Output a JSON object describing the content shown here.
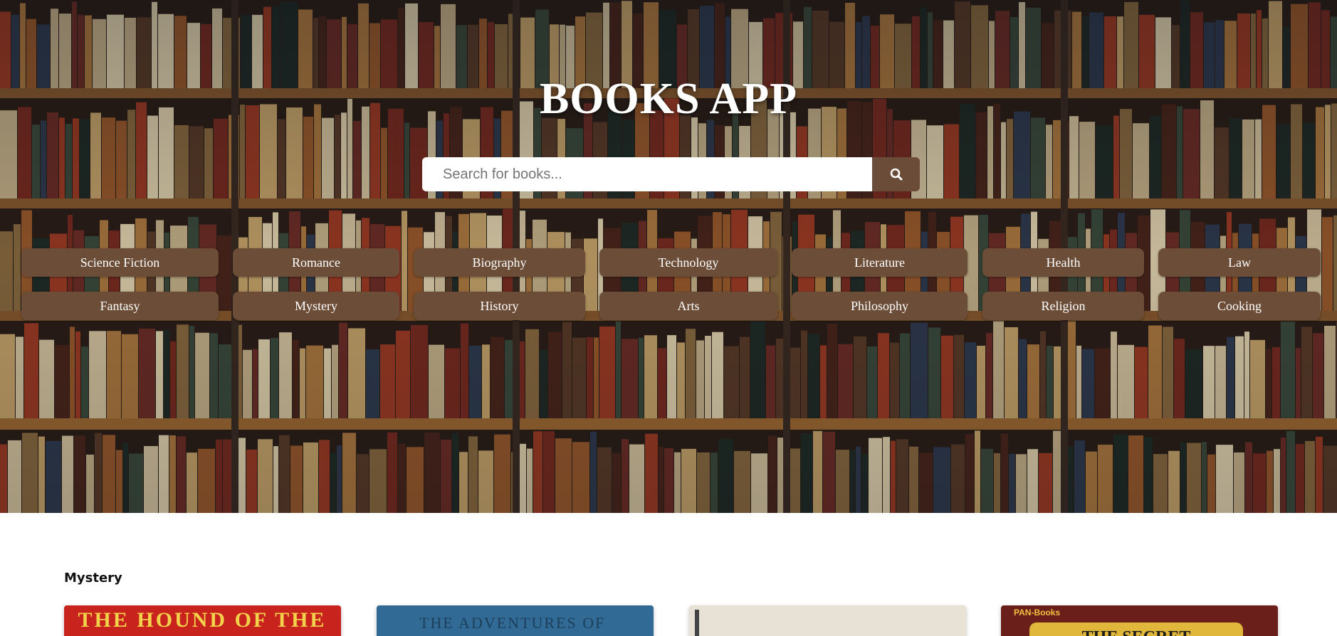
{
  "header": {
    "title": "BOOKS APP"
  },
  "search": {
    "placeholder": "Search for books...",
    "button_icon": "search-icon"
  },
  "categories": {
    "row1": [
      "Science Fiction",
      "Romance",
      "Biography",
      "Technology",
      "Literature",
      "Health",
      "Law"
    ],
    "row2": [
      "Fantasy",
      "Mystery",
      "History",
      "Arts",
      "Philosophy",
      "Religion",
      "Cooking"
    ]
  },
  "section": {
    "title": "Mystery",
    "books": [
      {
        "cover_text": "THE HOUND OF THE"
      },
      {
        "cover_text": "THE ADVENTURES OF"
      },
      {
        "cover_text": ""
      },
      {
        "cover_text": "THE SECRET",
        "publisher": "PAN-Books"
      }
    ]
  },
  "colors": {
    "accent": "#6c4d37",
    "hero_dark": "#2a1c14"
  }
}
